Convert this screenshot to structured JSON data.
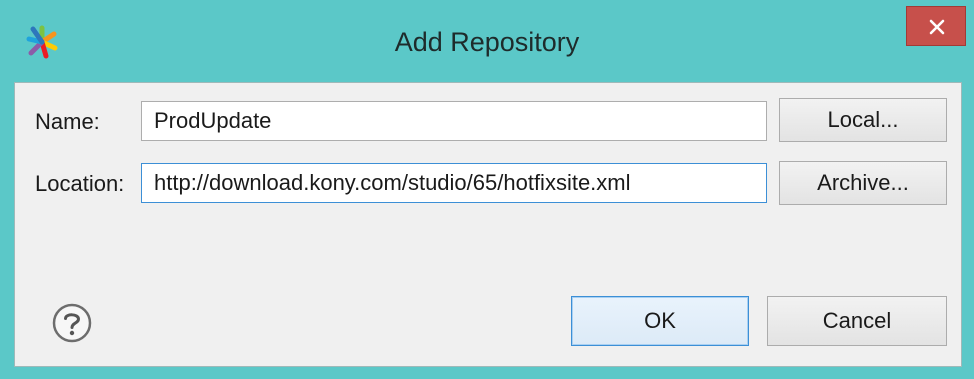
{
  "window": {
    "title": "Add Repository"
  },
  "form": {
    "name_label": "Name:",
    "name_value": "ProdUpdate",
    "location_label": "Location:",
    "location_value": "http://download.kony.com/studio/65/hotfixsite.xml"
  },
  "buttons": {
    "local_label": "Local...",
    "archive_label": "Archive...",
    "ok_label": "OK",
    "cancel_label": "Cancel"
  },
  "icons": {
    "app": "kony-app-icon",
    "close": "close-icon",
    "help": "help-icon"
  },
  "colors": {
    "titlebar": "#5bc8c8",
    "close_button": "#c7504b",
    "focus_border": "#3c8fd6"
  }
}
